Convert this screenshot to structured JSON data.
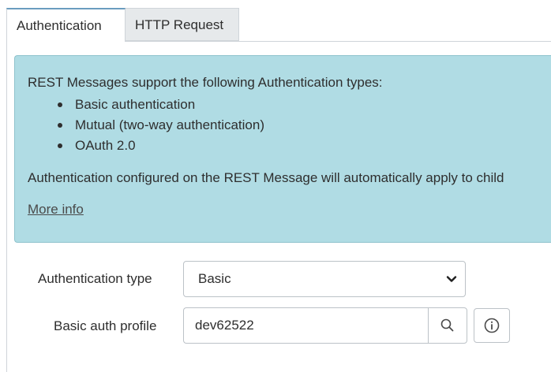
{
  "tabs": [
    {
      "label": "Authentication",
      "active": true
    },
    {
      "label": "HTTP Request",
      "active": false
    }
  ],
  "info_box": {
    "intro": "REST Messages support the following Authentication types:",
    "types": [
      "Basic authentication",
      "Mutual (two-way authentication)",
      "OAuth 2.0"
    ],
    "note": "Authentication configured on the REST Message will automatically apply to child",
    "link": "More info"
  },
  "form": {
    "auth_type": {
      "label": "Authentication type",
      "value": "Basic"
    },
    "basic_auth_profile": {
      "label": "Basic auth profile",
      "value": "dev62522"
    }
  },
  "colors": {
    "info_bg": "#b0dce4",
    "tab_active_border": "#6a9cbf"
  },
  "icons": [
    "chevron-down-icon",
    "search-icon",
    "info-icon"
  ]
}
